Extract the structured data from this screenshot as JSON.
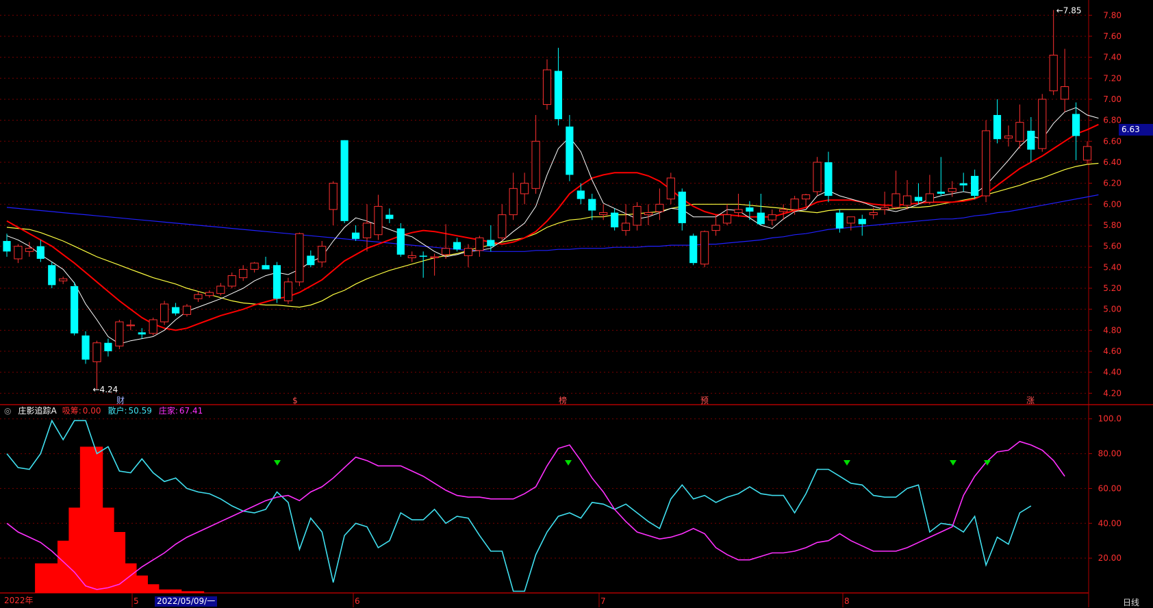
{
  "indicator": {
    "name": "庄影追踪A",
    "xichou_label": "吸筹:",
    "xichou_value": "0.00",
    "sanhu_label": "散户:",
    "sanhu_value": "50.59",
    "zhuangjia_label": "庄家:",
    "zhuangjia_value": "67.41"
  },
  "price_tag": "6.63",
  "max_label": "7.85",
  "min_label": "4.24",
  "events": [
    "财",
    "$",
    "榜",
    "预",
    "涨"
  ],
  "timeline": {
    "year": "2022年",
    "months": [
      "5",
      "6",
      "7",
      "8"
    ],
    "cursor_date": "2022/05/09/一",
    "period": "日线"
  },
  "colors": {
    "up": "#ff3030",
    "down": "#00ffff",
    "ma5": "#ffffff",
    "ma10": "#ff0000",
    "ma20": "#ffff40",
    "ma60": "#2020ff",
    "sanhu": "#40e0f0",
    "zhuangjia": "#ff30ff",
    "xichou": "#ff0000",
    "grid": "#7a0000"
  },
  "chart_data": [
    {
      "type": "candlestick",
      "ylim": [
        4.15,
        7.88
      ],
      "y_ticks": [
        "7.80",
        "7.60",
        "7.40",
        "7.20",
        "7.00",
        "6.80",
        "6.60",
        "6.40",
        "6.20",
        "6.00",
        "5.80",
        "5.60",
        "5.40",
        "5.20",
        "5.00",
        "4.80",
        "4.60",
        "4.40",
        "4.20"
      ],
      "ohlc": [
        [
          5.65,
          5.72,
          5.5,
          5.55
        ],
        [
          5.48,
          5.62,
          5.44,
          5.6
        ],
        [
          5.55,
          5.64,
          5.5,
          5.58
        ],
        [
          5.6,
          5.66,
          5.45,
          5.48
        ],
        [
          5.42,
          5.45,
          5.2,
          5.23
        ],
        [
          5.27,
          5.31,
          5.24,
          5.29
        ],
        [
          5.22,
          5.26,
          4.75,
          4.77
        ],
        [
          4.75,
          4.79,
          4.48,
          4.52
        ],
        [
          4.5,
          4.7,
          4.24,
          4.68
        ],
        [
          4.68,
          4.72,
          4.55,
          4.6
        ],
        [
          4.65,
          4.9,
          4.62,
          4.88
        ],
        [
          4.85,
          4.9,
          4.8,
          4.85
        ],
        [
          4.78,
          4.82,
          4.72,
          4.76
        ],
        [
          4.77,
          4.92,
          4.75,
          4.9
        ],
        [
          4.88,
          5.08,
          4.85,
          5.05
        ],
        [
          5.02,
          5.06,
          4.94,
          4.96
        ],
        [
          4.95,
          5.05,
          4.93,
          5.03
        ],
        [
          5.1,
          5.17,
          5.07,
          5.14
        ],
        [
          5.13,
          5.18,
          5.11,
          5.16
        ],
        [
          5.15,
          5.25,
          5.13,
          5.22
        ],
        [
          5.22,
          5.35,
          5.2,
          5.32
        ],
        [
          5.3,
          5.42,
          5.27,
          5.38
        ],
        [
          5.38,
          5.45,
          5.35,
          5.44
        ],
        [
          5.42,
          5.5,
          5.4,
          5.38
        ],
        [
          5.42,
          5.45,
          5.06,
          5.1
        ],
        [
          5.08,
          5.3,
          5.05,
          5.26
        ],
        [
          5.26,
          5.73,
          5.22,
          5.72
        ],
        [
          5.51,
          5.56,
          5.4,
          5.42
        ],
        [
          5.45,
          5.65,
          5.4,
          5.6
        ],
        [
          5.95,
          6.22,
          5.8,
          6.2
        ],
        [
          6.61,
          6.61,
          5.82,
          5.84
        ],
        [
          5.73,
          5.8,
          5.65,
          5.67
        ],
        [
          5.68,
          6.0,
          5.55,
          5.82
        ],
        [
          5.71,
          6.09,
          5.66,
          5.98
        ],
        [
          5.9,
          5.96,
          5.82,
          5.86
        ],
        [
          5.77,
          5.82,
          5.5,
          5.52
        ],
        [
          5.49,
          5.55,
          5.45,
          5.51
        ],
        [
          5.51,
          5.55,
          5.3,
          5.5
        ],
        [
          5.49,
          5.53,
          5.32,
          5.5
        ],
        [
          5.52,
          5.81,
          5.48,
          5.58
        ],
        [
          5.64,
          5.68,
          5.55,
          5.57
        ],
        [
          5.51,
          5.62,
          5.4,
          5.58
        ],
        [
          5.56,
          5.7,
          5.5,
          5.68
        ],
        [
          5.66,
          5.8,
          5.55,
          5.6
        ],
        [
          5.68,
          6.0,
          5.65,
          5.9
        ],
        [
          5.9,
          6.3,
          5.85,
          6.15
        ],
        [
          6.1,
          6.3,
          6.0,
          6.2
        ],
        [
          6.15,
          6.85,
          6.1,
          6.6
        ],
        [
          6.95,
          7.38,
          6.9,
          7.28
        ],
        [
          7.27,
          7.49,
          6.75,
          6.81
        ],
        [
          6.74,
          6.85,
          6.22,
          6.28
        ],
        [
          6.13,
          6.2,
          6.0,
          6.05
        ],
        [
          6.05,
          6.1,
          5.85,
          5.94
        ],
        [
          5.9,
          6.0,
          5.85,
          5.92
        ],
        [
          5.92,
          5.96,
          5.75,
          5.78
        ],
        [
          5.75,
          6.0,
          5.7,
          5.82
        ],
        [
          5.8,
          6.02,
          5.75,
          5.98
        ],
        [
          5.9,
          6.0,
          5.8,
          5.92
        ],
        [
          5.93,
          6.15,
          5.85,
          6.0
        ],
        [
          6.05,
          6.3,
          6.0,
          6.25
        ],
        [
          6.12,
          6.15,
          5.75,
          5.82
        ],
        [
          5.7,
          5.72,
          5.42,
          5.44
        ],
        [
          5.43,
          5.75,
          5.4,
          5.74
        ],
        [
          5.75,
          5.9,
          5.7,
          5.8
        ],
        [
          5.82,
          6.0,
          5.8,
          5.9
        ],
        [
          5.92,
          6.1,
          5.88,
          5.95
        ],
        [
          5.97,
          6.03,
          5.85,
          5.93
        ],
        [
          5.92,
          6.1,
          5.8,
          5.81
        ],
        [
          5.85,
          5.95,
          5.8,
          5.9
        ],
        [
          5.93,
          6.0,
          5.85,
          5.95
        ],
        [
          5.95,
          6.08,
          5.9,
          6.05
        ],
        [
          6.05,
          6.1,
          5.98,
          6.09
        ],
        [
          6.12,
          6.45,
          6.08,
          6.4
        ],
        [
          6.4,
          6.5,
          6.02,
          6.08
        ],
        [
          5.92,
          5.95,
          5.73,
          5.77
        ],
        [
          5.82,
          5.88,
          5.75,
          5.88
        ],
        [
          5.86,
          5.9,
          5.7,
          5.81
        ],
        [
          5.9,
          5.97,
          5.86,
          5.92
        ],
        [
          5.95,
          6.12,
          5.9,
          5.97
        ],
        [
          5.97,
          6.32,
          5.95,
          6.1
        ],
        [
          5.99,
          6.23,
          5.95,
          6.08
        ],
        [
          6.07,
          6.2,
          6.0,
          6.03
        ],
        [
          6.02,
          6.28,
          6.0,
          6.1
        ],
        [
          6.12,
          6.45,
          6.08,
          6.1
        ],
        [
          6.12,
          6.22,
          6.07,
          6.15
        ],
        [
          6.2,
          6.3,
          6.12,
          6.18
        ],
        [
          6.27,
          6.33,
          6.05,
          6.08
        ],
        [
          6.08,
          6.8,
          6.02,
          6.7
        ],
        [
          6.85,
          7.0,
          6.58,
          6.62
        ],
        [
          6.63,
          6.75,
          6.55,
          6.65
        ],
        [
          6.6,
          6.95,
          6.53,
          6.78
        ],
        [
          6.7,
          6.83,
          6.4,
          6.52
        ],
        [
          6.53,
          7.05,
          6.5,
          7.0
        ],
        [
          7.08,
          7.85,
          7.04,
          7.42
        ],
        [
          7.0,
          7.48,
          6.88,
          7.12
        ],
        [
          6.86,
          6.97,
          6.42,
          6.65
        ],
        [
          6.42,
          6.6,
          6.38,
          6.55
        ]
      ],
      "ma5": [
        5.7,
        5.66,
        5.6,
        5.52,
        5.45,
        5.38,
        5.25,
        5.05,
        4.9,
        4.74,
        4.67,
        4.7,
        4.72,
        4.74,
        4.8,
        4.9,
        4.98,
        5.02,
        5.06,
        5.1,
        5.15,
        5.2,
        5.27,
        5.32,
        5.35,
        5.33,
        5.38,
        5.45,
        5.5,
        5.65,
        5.78,
        5.87,
        5.84,
        5.8,
        5.76,
        5.72,
        5.69,
        5.62,
        5.55,
        5.5,
        5.52,
        5.55,
        5.56,
        5.58,
        5.65,
        5.74,
        5.82,
        5.98,
        6.28,
        6.53,
        6.64,
        6.5,
        6.23,
        6.01,
        5.96,
        5.91,
        5.86,
        5.88,
        5.92,
        5.96,
        5.95,
        5.88,
        5.88,
        5.88,
        5.95,
        5.94,
        5.87,
        5.8,
        5.77,
        5.86,
        5.93,
        5.95,
        6.08,
        6.13,
        6.08,
        6.05,
        6.02,
        5.98,
        5.95,
        5.93,
        5.96,
        6.0,
        6.05,
        6.08,
        6.1,
        6.12,
        6.1,
        6.18,
        6.3,
        6.42,
        6.55,
        6.65,
        6.62,
        6.77,
        6.88,
        6.92,
        6.85,
        6.82
      ],
      "ma10": [
        5.84,
        5.78,
        5.72,
        5.66,
        5.6,
        5.52,
        5.44,
        5.35,
        5.26,
        5.17,
        5.08,
        5.0,
        4.92,
        4.86,
        4.82,
        4.8,
        4.82,
        4.86,
        4.9,
        4.94,
        4.97,
        5.0,
        5.04,
        5.07,
        5.1,
        5.12,
        5.16,
        5.22,
        5.28,
        5.37,
        5.46,
        5.52,
        5.58,
        5.62,
        5.66,
        5.7,
        5.73,
        5.75,
        5.74,
        5.72,
        5.7,
        5.68,
        5.66,
        5.64,
        5.62,
        5.64,
        5.68,
        5.74,
        5.84,
        5.96,
        6.1,
        6.18,
        6.25,
        6.28,
        6.3,
        6.3,
        6.3,
        6.27,
        6.22,
        6.14,
        6.05,
        5.98,
        5.93,
        5.9,
        5.9,
        5.89,
        5.88,
        5.88,
        5.88,
        5.91,
        5.94,
        5.97,
        6.02,
        6.04,
        6.04,
        6.04,
        6.02,
        6.0,
        5.99,
        5.99,
        6.0,
        6.01,
        6.02,
        6.02,
        6.02,
        6.03,
        6.05,
        6.1,
        6.18,
        6.26,
        6.34,
        6.4,
        6.46,
        6.53,
        6.6,
        6.67,
        6.71,
        6.76
      ],
      "ma20": [
        5.78,
        5.77,
        5.76,
        5.73,
        5.69,
        5.65,
        5.6,
        5.55,
        5.5,
        5.46,
        5.42,
        5.38,
        5.34,
        5.3,
        5.27,
        5.24,
        5.2,
        5.17,
        5.14,
        5.11,
        5.08,
        5.06,
        5.05,
        5.04,
        5.04,
        5.03,
        5.02,
        5.04,
        5.08,
        5.14,
        5.18,
        5.24,
        5.29,
        5.33,
        5.37,
        5.4,
        5.43,
        5.46,
        5.49,
        5.51,
        5.53,
        5.56,
        5.59,
        5.61,
        5.64,
        5.66,
        5.68,
        5.72,
        5.78,
        5.82,
        5.85,
        5.86,
        5.88,
        5.88,
        5.9,
        5.9,
        5.91,
        5.92,
        5.93,
        5.96,
        5.98,
        6.0,
        6.0,
        6.0,
        6.0,
        6.0,
        5.99,
        5.98,
        5.97,
        5.96,
        5.94,
        5.93,
        5.92,
        5.94,
        5.95,
        5.95,
        5.95,
        5.95,
        5.95,
        5.96,
        5.97,
        5.97,
        5.98,
        6.0,
        6.02,
        6.04,
        6.06,
        6.09,
        6.12,
        6.15,
        6.18,
        6.22,
        6.25,
        6.29,
        6.33,
        6.36,
        6.38,
        6.39
      ],
      "ma60": [
        5.97,
        5.96,
        5.95,
        5.94,
        5.93,
        5.92,
        5.91,
        5.9,
        5.89,
        5.88,
        5.87,
        5.86,
        5.85,
        5.84,
        5.83,
        5.82,
        5.81,
        5.8,
        5.79,
        5.78,
        5.77,
        5.76,
        5.75,
        5.74,
        5.73,
        5.72,
        5.71,
        5.7,
        5.69,
        5.68,
        5.67,
        5.66,
        5.65,
        5.64,
        5.63,
        5.62,
        5.61,
        5.6,
        5.59,
        5.58,
        5.57,
        5.56,
        5.56,
        5.55,
        5.55,
        5.55,
        5.55,
        5.56,
        5.56,
        5.57,
        5.57,
        5.58,
        5.58,
        5.58,
        5.59,
        5.59,
        5.59,
        5.6,
        5.6,
        5.61,
        5.61,
        5.61,
        5.62,
        5.62,
        5.63,
        5.64,
        5.65,
        5.66,
        5.68,
        5.69,
        5.71,
        5.72,
        5.74,
        5.76,
        5.77,
        5.78,
        5.79,
        5.8,
        5.81,
        5.82,
        5.83,
        5.84,
        5.85,
        5.86,
        5.86,
        5.87,
        5.89,
        5.9,
        5.92,
        5.93,
        5.95,
        5.97,
        5.99,
        6.01,
        6.03,
        6.05,
        6.07,
        6.09
      ]
    },
    {
      "type": "line",
      "ylim": [
        0,
        105
      ],
      "y_ticks": [
        "100.0",
        "80.00",
        "60.00",
        "40.00",
        "20.00"
      ],
      "series": [
        {
          "name": "散户",
          "values": [
            80,
            72,
            71,
            80,
            99,
            88,
            99,
            99,
            80,
            84,
            70,
            69,
            77,
            69,
            64,
            66,
            60,
            58,
            57,
            54,
            50,
            47,
            46,
            48,
            58,
            52,
            25,
            43,
            35,
            6,
            33,
            40,
            38,
            26,
            30,
            46,
            42,
            42,
            48,
            40,
            44,
            43,
            33,
            24,
            24,
            1,
            1,
            22,
            35,
            44,
            46,
            43,
            52,
            51,
            48,
            51,
            46,
            41,
            37,
            54,
            62,
            54,
            56,
            52,
            55,
            57,
            61,
            57,
            56,
            56,
            46,
            57,
            71,
            71,
            67,
            63,
            62,
            56,
            55,
            55,
            60,
            62,
            35,
            40,
            39,
            35,
            44,
            16,
            32,
            28,
            46,
            50
          ]
        },
        {
          "name": "庄家",
          "values": [
            40,
            35,
            32,
            29,
            24,
            18,
            12,
            4,
            2,
            3,
            5,
            10,
            15,
            19,
            23,
            28,
            32,
            35,
            38,
            41,
            44,
            47,
            50,
            53,
            55,
            56,
            53,
            58,
            61,
            66,
            72,
            78,
            76,
            73,
            73,
            73,
            70,
            67,
            63,
            59,
            56,
            55,
            55,
            54,
            54,
            54,
            57,
            61,
            73,
            83,
            85,
            76,
            66,
            58,
            48,
            41,
            35,
            33,
            31,
            32,
            34,
            37,
            34,
            26,
            22,
            19,
            19,
            21,
            23,
            23,
            24,
            26,
            29,
            30,
            34,
            30,
            27,
            24,
            24,
            24,
            26,
            29,
            32,
            35,
            38,
            56,
            67,
            75,
            81,
            82,
            87,
            85,
            82,
            76,
            67
          ]
        },
        {
          "name": "吸筹",
          "values": [
            0,
            0,
            0,
            17,
            17,
            30,
            49,
            84,
            84,
            49,
            35,
            17,
            10,
            5,
            2,
            2,
            1,
            1,
            0,
            0,
            0,
            0,
            0,
            0,
            0,
            0,
            0,
            0,
            0,
            0,
            0,
            0,
            0,
            0,
            0,
            0,
            0,
            0,
            0,
            0,
            0,
            0,
            0,
            0,
            0,
            0,
            0,
            0,
            0,
            0,
            0,
            0,
            0,
            0,
            0,
            0,
            0,
            0,
            0,
            0,
            0,
            0,
            0,
            0,
            0,
            0,
            0,
            0,
            0,
            0,
            0,
            0,
            0,
            0,
            0,
            0,
            0,
            0,
            0,
            0,
            0,
            0,
            0,
            0,
            0,
            0,
            0,
            0,
            0,
            0,
            0,
            0,
            0,
            0,
            0,
            0,
            0,
            0,
            0
          ]
        }
      ]
    }
  ]
}
